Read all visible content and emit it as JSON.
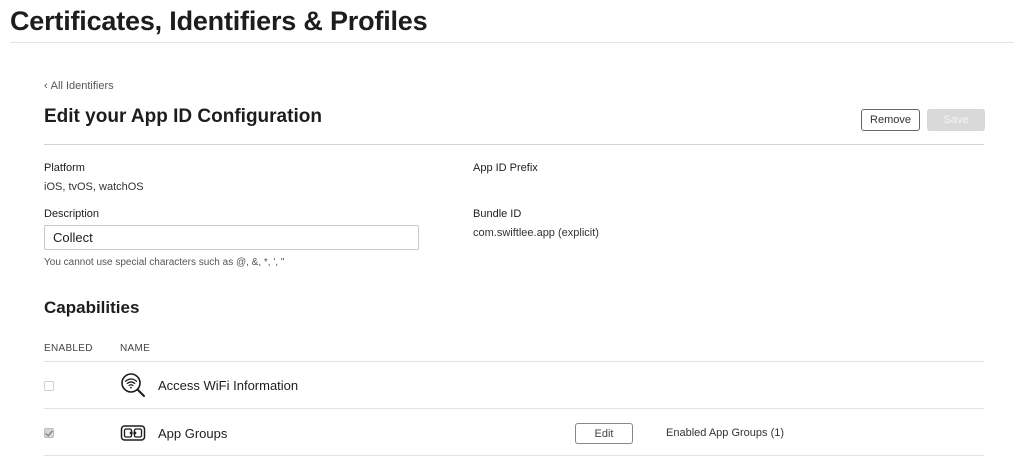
{
  "header": {
    "title": "Certificates, Identifiers & Profiles"
  },
  "nav": {
    "back_label": "All Identifiers"
  },
  "main": {
    "title": "Edit your App ID Configuration",
    "remove_label": "Remove",
    "save_label": "Save"
  },
  "fields": {
    "platform_label": "Platform",
    "platform_value": "iOS, tvOS, watchOS",
    "app_id_prefix_label": "App ID Prefix",
    "description_label": "Description",
    "description_value": "Collect",
    "description_hint": "You cannot use special characters such as @, &, *, ', \"",
    "bundle_id_label": "Bundle ID",
    "bundle_id_value": "com.swiftlee.app (explicit)"
  },
  "capabilities": {
    "title": "Capabilities",
    "col_enabled": "ENABLED",
    "col_name": "NAME",
    "rows": [
      {
        "name": "Access WiFi Information",
        "icon": "wifi-search-icon",
        "enabled": false
      },
      {
        "name": "App Groups",
        "icon": "app-groups-icon",
        "enabled": true,
        "edit_label": "Edit",
        "status": "Enabled App Groups (1)"
      }
    ]
  },
  "colors": {
    "text": "#1d1d1f",
    "rule": "#d2d2d2",
    "save_disabled": "#d9d9d9"
  }
}
